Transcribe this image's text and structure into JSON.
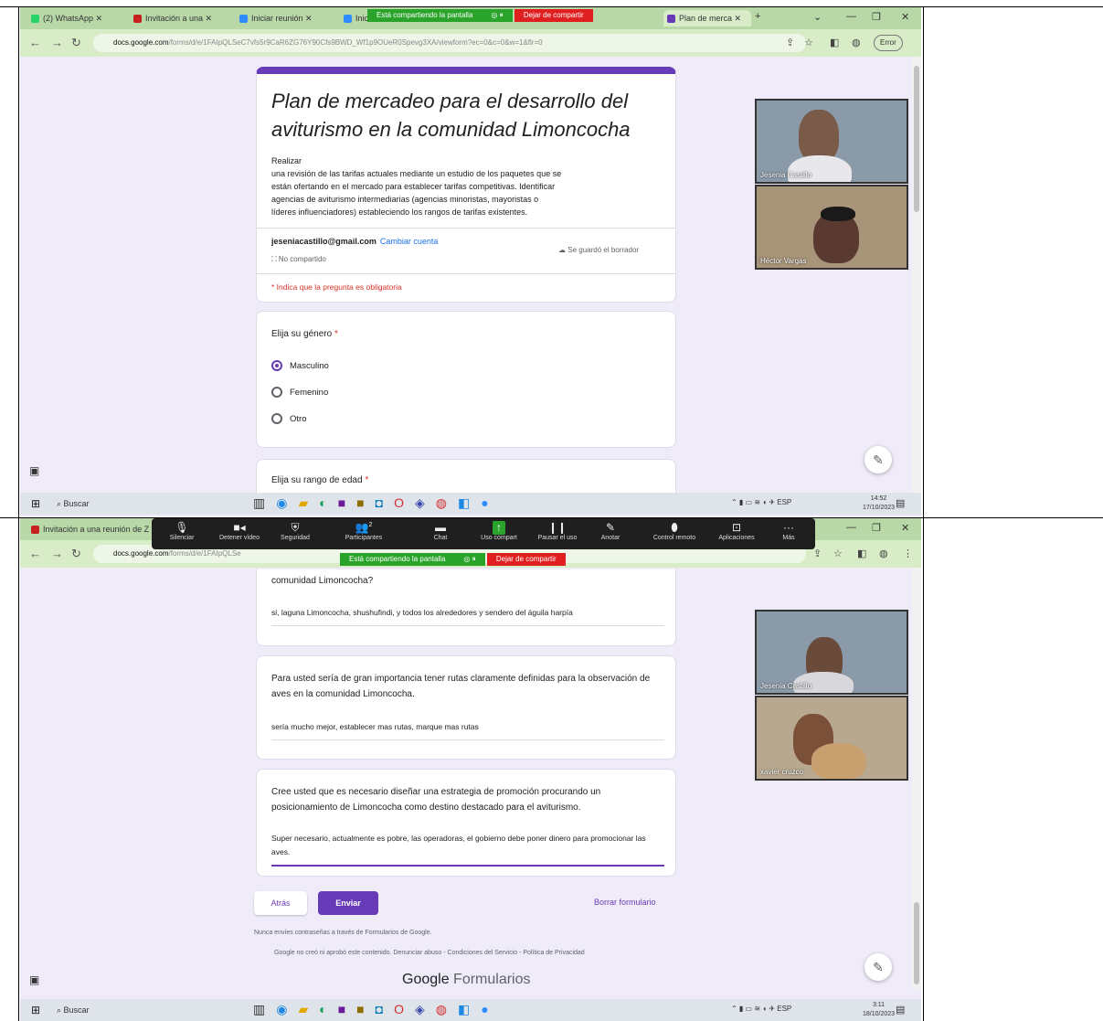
{
  "shot1": {
    "tabs": [
      {
        "label": "(2) WhatsApp",
        "icon_color": "#25d366"
      },
      {
        "label": "Invitación a una",
        "icon_color": "#c5221f"
      },
      {
        "label": "Iniciar reunión",
        "icon_color": "#2d8cff"
      },
      {
        "label": "Inic",
        "icon_color": "#2d8cff"
      },
      {
        "label": "Plan de merca",
        "icon_color": "#673ab7"
      }
    ],
    "share_banner": {
      "sharing_text": "Está compartiendo la pantalla",
      "stop_text": "Dejar de compartir"
    },
    "url_domain": "docs.google.com",
    "url_rest": "/forms/d/e/1FAIpQLSeC7vfs5r9CaR6ZG76Y90Cfs9BWD_Wf1p9OUeR0Spevg3XA/viewform?ec=0&c=0&w=1&flr=0",
    "error_label": "Error",
    "form": {
      "title": "Plan de mercadeo para el desarrollo del aviturismo en la comunidad Limoncocha",
      "description_lines": [
        "Realizar",
        "una revisión de las tarifas actuales mediante un estudio de los paquetes que se",
        "están ofertando en el mercado para establecer tarifas competitivas. Identificar",
        "agencias de aviturismo intermediarias (agencias minoristas, mayoristas o",
        "líderes influenciadores) estableciendo los rangos de tarifas existentes."
      ],
      "email": "jeseniacastillo@gmail.com",
      "switch_account": "Cambiar cuenta",
      "not_shared": "No compartido",
      "save_draft": "Se guardó el borrador",
      "required_note": "* Indica que la pregunta es obligatoria",
      "q_gender": "Elija su género",
      "gender_options": [
        "Masculino",
        "Femenino",
        "Otro"
      ],
      "gender_selected": "Masculino",
      "q_age": "Elija su rango de edad"
    },
    "participants": [
      {
        "name": "Jesenia Castillo",
        "bg": "#8a9aa8"
      },
      {
        "name": "Héctor Vargas",
        "bg": "#a89478"
      }
    ],
    "taskbar": {
      "search": "Buscar",
      "clock_time": "14:52",
      "clock_date": "17/10/2023",
      "lang": "ESP"
    }
  },
  "shot2": {
    "tabs": [
      {
        "label": "Invitación a una reunión de Z",
        "icon_color": "#c5221f"
      }
    ],
    "zoom_toolbar": [
      {
        "label": "Silenciar",
        "icon": "mic-icon"
      },
      {
        "label": "Detener vídeo",
        "icon": "video-icon"
      },
      {
        "label": "Seguridad",
        "icon": "shield-icon"
      },
      {
        "label": "Participantes",
        "icon": "participants-icon"
      },
      {
        "label": "Chat",
        "icon": "chat-icon"
      },
      {
        "label": "Uso compart",
        "icon": "share-icon"
      },
      {
        "label": "Pausar el uso",
        "icon": "pause-icon"
      },
      {
        "label": "Anotar",
        "icon": "annotate-icon"
      },
      {
        "label": "Control remoto",
        "icon": "remote-icon"
      },
      {
        "label": "Aplicaciones",
        "icon": "apps-icon"
      },
      {
        "label": "Más",
        "icon": "more-icon"
      }
    ],
    "participants_count": "2",
    "share_banner": {
      "sharing_text": "Está compartiendo la pantalla",
      "stop_text": "Dejar de compartir"
    },
    "url_domain": "docs.google.com",
    "url_rest": "/forms/d/e/1FAIpQLSe",
    "form": {
      "q_prev_tail": "comunidad Limoncocha?",
      "a_prev": "si, laguna Limoncocha, shushufindi, y todos los alrededores y sendero del águila harpía",
      "q_routes": "Para usted sería de gran importancia tener rutas claramente definidas para la observación de aves en la comunidad Limoncocha.",
      "a_routes": "sería mucho mejor, establecer mas rutas, marque mas rutas",
      "q_promo": "Cree usted que es necesario diseñar una estrategia de promoción procurando un posicionamiento de Limoncocha como destino destacado para el aviturismo.",
      "a_promo": "Super necesario, actualmente es pobre, las operadoras, el gobierno debe poner dinero para promocionar las aves.",
      "back": "Atrás",
      "send": "Enviar",
      "clear": "Borrar formulario",
      "footer_note": "Nunca envíes contraseñas a través de Formularios de Google.",
      "footer_links": "Google no creó ni aprobó este contenido. Denunciar abuso - Condiciones del Servicio - Política de Privacidad",
      "brand_google": "Google",
      "brand_forms": "Formularios"
    },
    "participants": [
      {
        "name": "Jesenia Castillo",
        "bg": "#8a9aa8"
      },
      {
        "name": "xavier cruzco",
        "bg": "#b8a890"
      }
    ],
    "taskbar": {
      "search": "Buscar",
      "clock_time": "3:11",
      "clock_date": "18/10/2023",
      "lang": "ESP"
    }
  }
}
